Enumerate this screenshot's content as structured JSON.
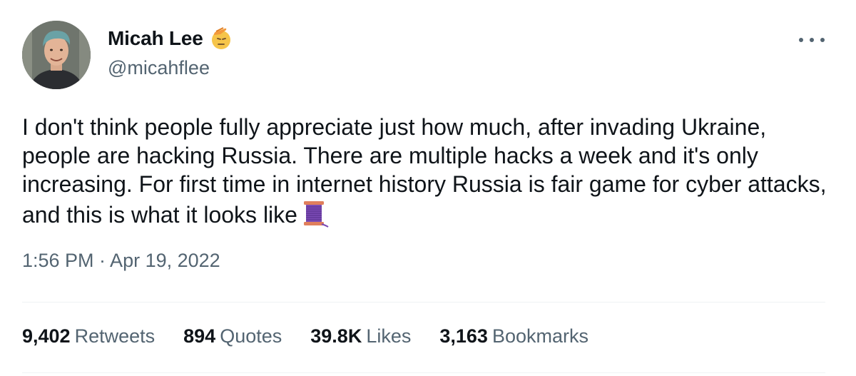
{
  "tweet": {
    "author": {
      "display_name": "Micah Lee",
      "handle": "@micahflee",
      "badge_icon": "saluting-face-emoji",
      "avatar_icon": "profile-photo"
    },
    "text": "I don't think people fully appreciate just how much, after invading Ukraine, people are hacking Russia. There are multiple hacks a week and it's only increasing. For first time in internet history Russia is fair game for cyber attacks, and this is what it looks like",
    "text_emoji": "thread-spool-emoji",
    "timestamp": "1:56 PM · Apr 19, 2022",
    "stats": [
      {
        "value": "9,402",
        "label": "Retweets"
      },
      {
        "value": "894",
        "label": "Quotes"
      },
      {
        "value": "39.8K",
        "label": "Likes"
      },
      {
        "value": "3,163",
        "label": "Bookmarks"
      }
    ]
  },
  "colors": {
    "text_primary": "#0f1419",
    "text_secondary": "#536471",
    "divider": "#eff3f4",
    "background": "#ffffff"
  }
}
